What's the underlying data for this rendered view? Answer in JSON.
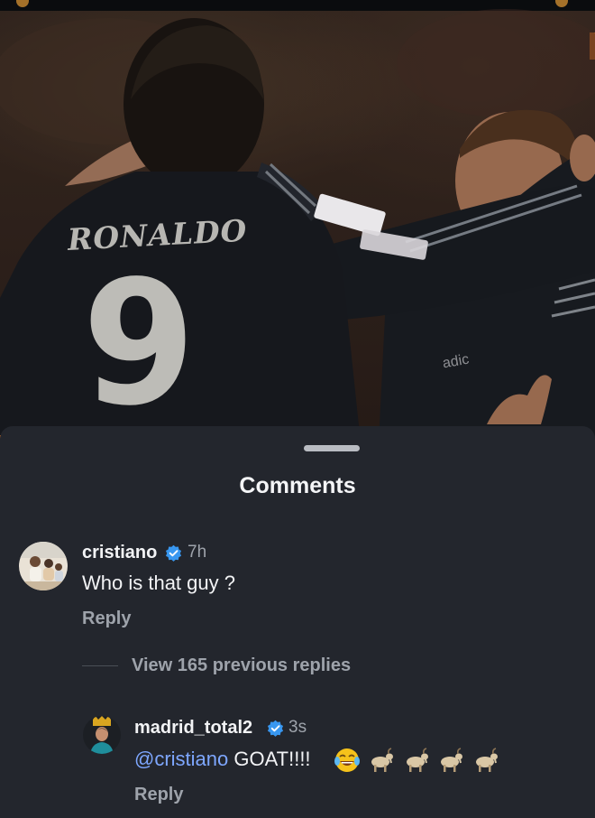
{
  "sheet": {
    "title": "Comments"
  },
  "photo": {
    "jersey_name": "RONALDO",
    "jersey_number": "9",
    "brand_text": "adic"
  },
  "comments": [
    {
      "username": "cristiano",
      "verified": true,
      "time": "7h",
      "text": "Who is that guy ?",
      "reply_label": "Reply"
    }
  ],
  "view_replies_label": "View 165 previous replies",
  "replies": [
    {
      "username": "madrid_total2",
      "verified": true,
      "time": "3s",
      "mention": "@cristiano",
      "text": "GOAT!!!!",
      "emojis": [
        "face-with-tears-of-joy",
        "goat",
        "goat",
        "goat",
        "goat"
      ],
      "reply_label": "Reply"
    }
  ],
  "colors": {
    "sheet_background": "#23262d",
    "mention": "#7ea7ff",
    "verified_badge": "#3897f0",
    "muted_text": "#9ea3ab"
  }
}
